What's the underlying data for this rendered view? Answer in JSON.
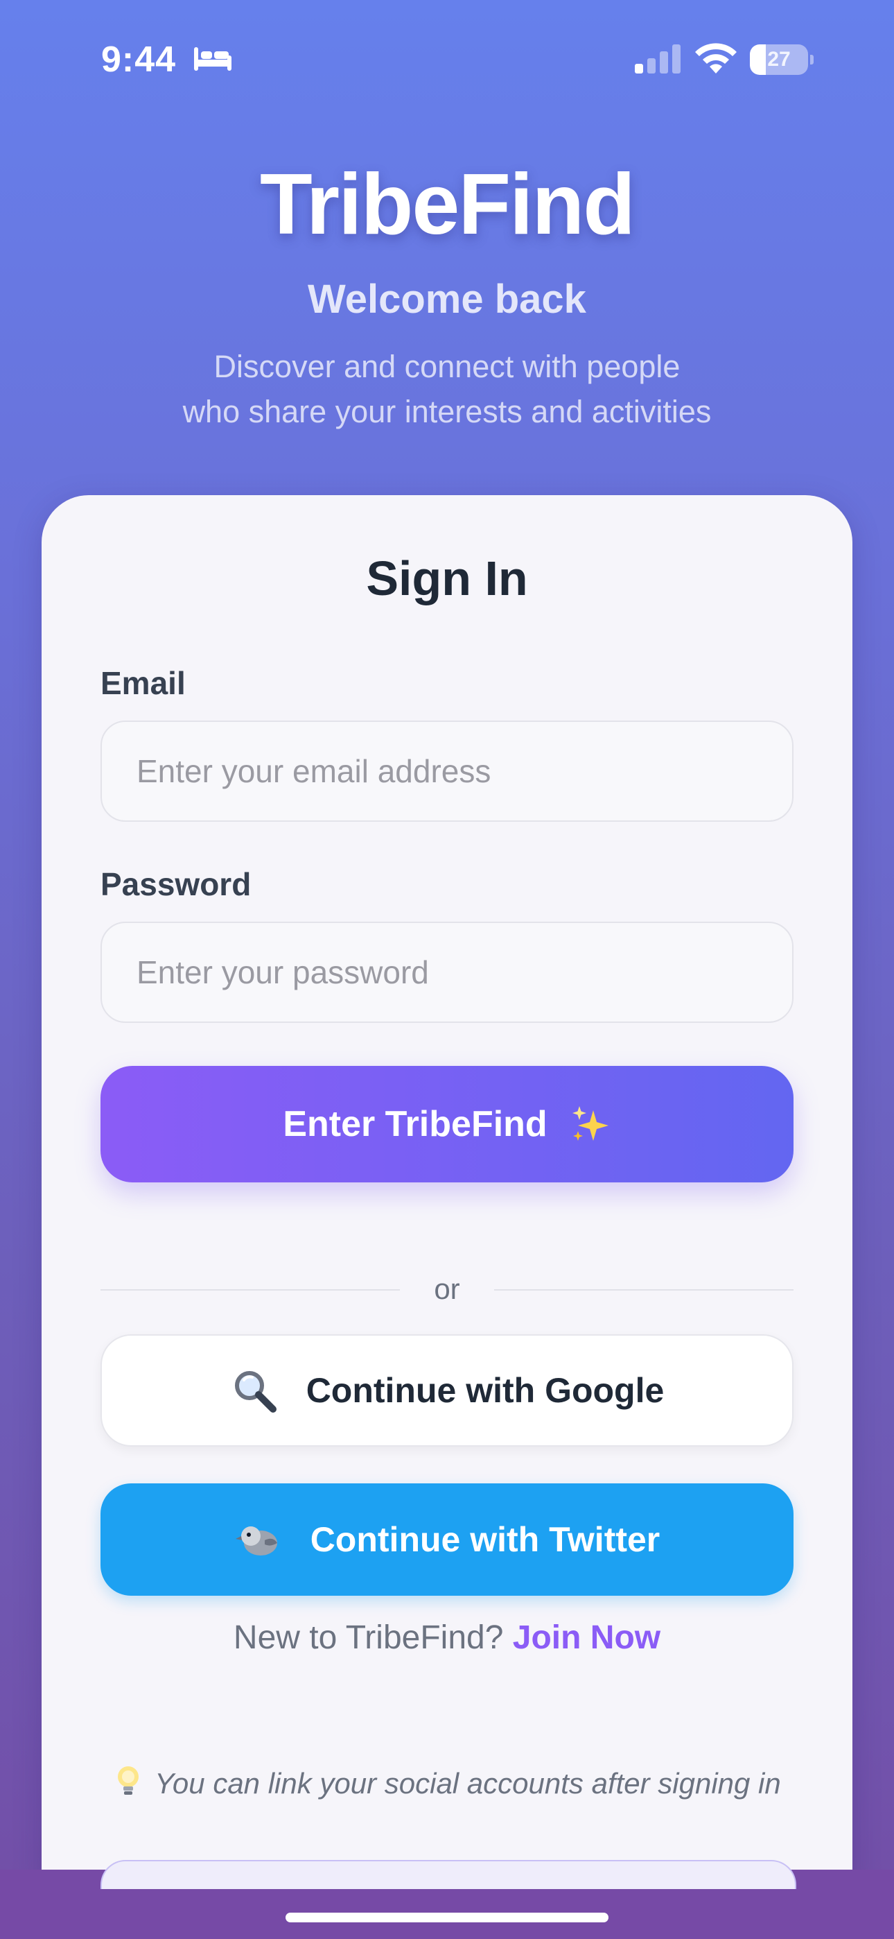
{
  "status_bar": {
    "time": "9:44",
    "battery_level": "27",
    "battery_fraction": 0.27,
    "icons": [
      "sleep-bed-icon",
      "cellular-signal-icon",
      "wifi-icon",
      "battery-icon"
    ]
  },
  "hero": {
    "title": "TribeFind",
    "welcome": "Welcome back",
    "subtitle_line1": "Discover and connect with people",
    "subtitle_line2": "who share your interests and activities"
  },
  "form": {
    "title": "Sign In",
    "email_label": "Email",
    "email_placeholder": "Enter your email address",
    "password_label": "Password",
    "password_placeholder": "Enter your password",
    "submit_label": "Enter TribeFind",
    "submit_icon": "sparkles-icon"
  },
  "divider_text": "or",
  "social": {
    "google_label": "Continue with Google",
    "google_icon": "magnifying-glass-icon",
    "twitter_label": "Continue with Twitter",
    "twitter_icon": "bird-icon"
  },
  "footer": {
    "prompt": "New to TribeFind?",
    "join_label": "Join Now",
    "tip": "You can link your social accounts after signing in",
    "tip_icon": "lightbulb-icon"
  },
  "colors": {
    "gradient_top": "#6680ec",
    "gradient_bottom": "#734ea6",
    "accent_purple": "#8b5cf6",
    "accent_indigo": "#6366f1",
    "twitter_blue": "#1da1f2"
  }
}
